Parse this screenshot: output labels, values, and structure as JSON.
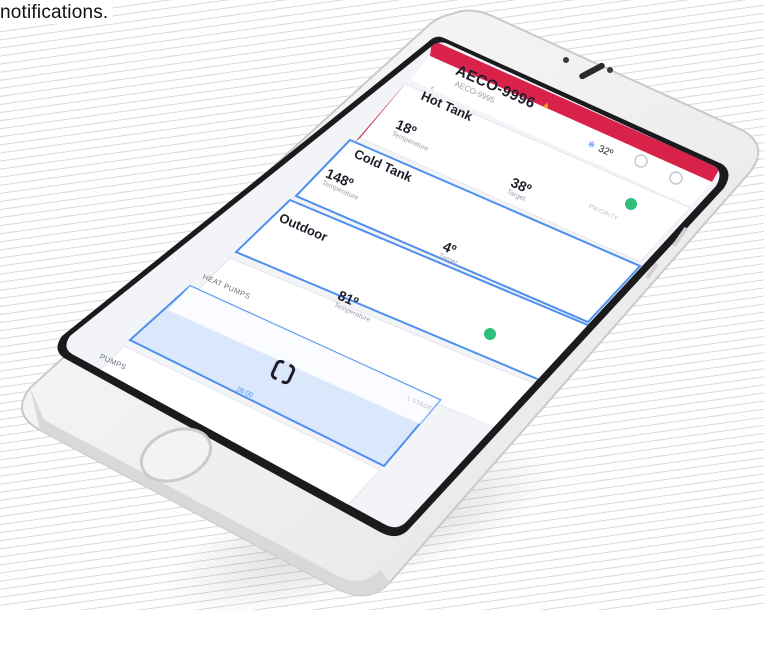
{
  "headline": "notifications.",
  "device": {
    "title": "AECO-9996",
    "subtitle": "AECO-9995",
    "back_icon": "chevron-left-icon",
    "warning_icon": "warning-triangle-icon"
  },
  "hot_tank": {
    "name": "Hot Tank",
    "temperature": "18º",
    "temperature_label": "Temperature",
    "outdoor_reading": "32º",
    "snow_icon": "snowflake-icon"
  },
  "cold_tank": {
    "name": "Cold Tank",
    "temperature": "148º",
    "temperature_label": "Temperature",
    "target": "38º",
    "target_label": "Target",
    "priority_label": "PRIORITY"
  },
  "outdoor": {
    "name": "Outdoor",
    "target": "4º",
    "target_label": "Target"
  },
  "heat_pumps": {
    "label": "HEAT PUMPS",
    "temperature": "81º",
    "temperature_label": "Temperature"
  },
  "pump_card": {
    "time": "26:00",
    "stage": "1 STAGE"
  },
  "pumps": {
    "label": "PUMPS"
  },
  "colors": {
    "accent_red": "#d8224a",
    "accent_blue": "#4f8ff0",
    "check_green": "#2fbf7a",
    "tile_blue": "#dbe8fb"
  }
}
